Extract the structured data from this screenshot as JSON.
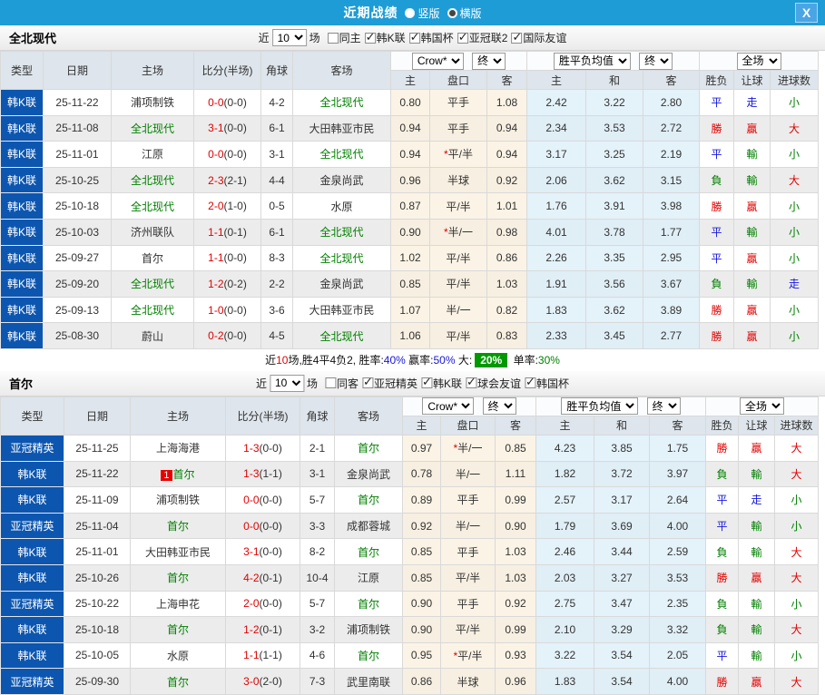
{
  "titlebar": {
    "title": "近期战绩",
    "radio_vertical": "竖版",
    "radio_horizontal": "横版",
    "vertical_checked": false,
    "horizontal_checked": true,
    "close_label": "X"
  },
  "colors": {
    "titlebar_bg": "#1e9cd6",
    "type_column_bg": "#0c56b0",
    "win_red": "#e10000",
    "lose_green": "#008000",
    "draw_blue": "#1515dd",
    "badge_green": "#009900"
  },
  "sections": [
    {
      "team": "全北现代",
      "filter": {
        "near_label": "近",
        "count_value": "10",
        "games_label": "场",
        "same_label": "同主",
        "same_checked": false,
        "leagues": [
          {
            "label": "韩K联",
            "checked": true
          },
          {
            "label": "韩国杯",
            "checked": true
          },
          {
            "label": "亚冠联2",
            "checked": true
          },
          {
            "label": "国际友谊",
            "checked": true
          }
        ]
      },
      "controls": {
        "bookmaker": "Crow*",
        "final1": "终",
        "avg": "胜平负均值",
        "final2": "终",
        "scope": "全场"
      },
      "header": {
        "type": "类型",
        "date": "日期",
        "home": "主场",
        "score": "比分(半场)",
        "corner": "角球",
        "away": "客场",
        "h": "主",
        "pan": "盘口",
        "a": "客",
        "h2": "主",
        "draw": "和",
        "a2": "客",
        "result": "胜负",
        "handicap_result": "让球",
        "goals": "进球数"
      },
      "rows": [
        {
          "type": "韩K联",
          "date": "25-11-22",
          "badge": "",
          "home": "浦项制铁",
          "home_c": "",
          "score": "0-0",
          "half": "(0-0)",
          "corner": "4-2",
          "away": "全北现代",
          "away_c": "green",
          "o1h": "0.80",
          "star": "",
          "pan": "平手",
          "o1a": "1.08",
          "o2h": "2.42",
          "o2d": "3.22",
          "o2a": "2.80",
          "res": "平",
          "res_c": "blue",
          "let": "走",
          "let_c": "blue",
          "goal": "小",
          "goal_c": "green"
        },
        {
          "type": "韩K联",
          "date": "25-11-08",
          "badge": "",
          "home": "全北现代",
          "home_c": "green",
          "score": "3-1",
          "half": "(0-0)",
          "corner": "6-1",
          "away": "大田韩亚市民",
          "away_c": "",
          "o1h": "0.94",
          "star": "",
          "pan": "平手",
          "o1a": "0.94",
          "o2h": "2.34",
          "o2d": "3.53",
          "o2a": "2.72",
          "res": "勝",
          "res_c": "red",
          "let": "贏",
          "let_c": "red",
          "goal": "大",
          "goal_c": "red"
        },
        {
          "type": "韩K联",
          "date": "25-11-01",
          "badge": "",
          "home": "江原",
          "home_c": "",
          "score": "0-0",
          "half": "(0-0)",
          "corner": "3-1",
          "away": "全北现代",
          "away_c": "green",
          "o1h": "0.94",
          "star": "*",
          "pan": "平/半",
          "o1a": "0.94",
          "o2h": "3.17",
          "o2d": "3.25",
          "o2a": "2.19",
          "res": "平",
          "res_c": "blue",
          "let": "輸",
          "let_c": "green",
          "goal": "小",
          "goal_c": "green"
        },
        {
          "type": "韩K联",
          "date": "25-10-25",
          "badge": "",
          "home": "全北现代",
          "home_c": "green",
          "score": "2-3",
          "half": "(2-1)",
          "corner": "4-4",
          "away": "金泉尚武",
          "away_c": "",
          "o1h": "0.96",
          "star": "",
          "pan": "半球",
          "o1a": "0.92",
          "o2h": "2.06",
          "o2d": "3.62",
          "o2a": "3.15",
          "res": "負",
          "res_c": "green",
          "let": "輸",
          "let_c": "green",
          "goal": "大",
          "goal_c": "red"
        },
        {
          "type": "韩K联",
          "date": "25-10-18",
          "badge": "",
          "home": "全北现代",
          "home_c": "green",
          "score": "2-0",
          "half": "(1-0)",
          "corner": "0-5",
          "away": "水原",
          "away_c": "",
          "o1h": "0.87",
          "star": "",
          "pan": "平/半",
          "o1a": "1.01",
          "o2h": "1.76",
          "o2d": "3.91",
          "o2a": "3.98",
          "res": "勝",
          "res_c": "red",
          "let": "贏",
          "let_c": "red",
          "goal": "小",
          "goal_c": "green"
        },
        {
          "type": "韩K联",
          "date": "25-10-03",
          "badge": "",
          "home": "济州联队",
          "home_c": "",
          "score": "1-1",
          "half": "(0-1)",
          "corner": "6-1",
          "away": "全北现代",
          "away_c": "green",
          "o1h": "0.90",
          "star": "*",
          "pan": "半/一",
          "o1a": "0.98",
          "o2h": "4.01",
          "o2d": "3.78",
          "o2a": "1.77",
          "res": "平",
          "res_c": "blue",
          "let": "輸",
          "let_c": "green",
          "goal": "小",
          "goal_c": "green"
        },
        {
          "type": "韩K联",
          "date": "25-09-27",
          "badge": "",
          "home": "首尔",
          "home_c": "",
          "score": "1-1",
          "half": "(0-0)",
          "corner": "8-3",
          "away": "全北现代",
          "away_c": "green",
          "o1h": "1.02",
          "star": "",
          "pan": "平/半",
          "o1a": "0.86",
          "o2h": "2.26",
          "o2d": "3.35",
          "o2a": "2.95",
          "res": "平",
          "res_c": "blue",
          "let": "贏",
          "let_c": "red",
          "goal": "小",
          "goal_c": "green"
        },
        {
          "type": "韩K联",
          "date": "25-09-20",
          "badge": "",
          "home": "全北现代",
          "home_c": "green",
          "score": "1-2",
          "half": "(0-2)",
          "corner": "2-2",
          "away": "金泉尚武",
          "away_c": "",
          "o1h": "0.85",
          "star": "",
          "pan": "平/半",
          "o1a": "1.03",
          "o2h": "1.91",
          "o2d": "3.56",
          "o2a": "3.67",
          "res": "負",
          "res_c": "green",
          "let": "輸",
          "let_c": "green",
          "goal": "走",
          "goal_c": "blue"
        },
        {
          "type": "韩K联",
          "date": "25-09-13",
          "badge": "",
          "home": "全北现代",
          "home_c": "green",
          "score": "1-0",
          "half": "(0-0)",
          "corner": "3-6",
          "away": "大田韩亚市民",
          "away_c": "",
          "o1h": "1.07",
          "star": "",
          "pan": "半/一",
          "o1a": "0.82",
          "o2h": "1.83",
          "o2d": "3.62",
          "o2a": "3.89",
          "res": "勝",
          "res_c": "red",
          "let": "贏",
          "let_c": "red",
          "goal": "小",
          "goal_c": "green"
        },
        {
          "type": "韩K联",
          "date": "25-08-30",
          "badge": "",
          "home": "蔚山",
          "home_c": "",
          "score": "0-2",
          "half": "(0-0)",
          "corner": "4-5",
          "away": "全北现代",
          "away_c": "green",
          "o1h": "1.06",
          "star": "",
          "pan": "平/半",
          "o1a": "0.83",
          "o2h": "2.33",
          "o2d": "3.45",
          "o2a": "2.77",
          "res": "勝",
          "res_c": "red",
          "let": "贏",
          "let_c": "red",
          "goal": "小",
          "goal_c": "green"
        }
      ],
      "summary": [
        {
          "t": "近",
          "c": ""
        },
        {
          "t": "10",
          "c": "red"
        },
        {
          "t": "场,胜4平4负2, 胜率:",
          "c": ""
        },
        {
          "t": "40%",
          "c": "blue"
        },
        {
          "t": " 赢率:",
          "c": ""
        },
        {
          "t": "50%",
          "c": "blue"
        },
        {
          "t": " 大:",
          "c": ""
        },
        {
          "t": "20%",
          "c": "badge"
        },
        {
          "t": " 单率:",
          "c": ""
        },
        {
          "t": "30%",
          "c": "green"
        }
      ]
    },
    {
      "team": "首尔",
      "filter": {
        "near_label": "近",
        "count_value": "10",
        "games_label": "场",
        "same_label": "同客",
        "same_checked": false,
        "leagues": [
          {
            "label": "亚冠精英",
            "checked": true
          },
          {
            "label": "韩K联",
            "checked": true
          },
          {
            "label": "球会友谊",
            "checked": true
          },
          {
            "label": "韩国杯",
            "checked": true
          }
        ]
      },
      "controls": {
        "bookmaker": "Crow*",
        "final1": "终",
        "avg": "胜平负均值",
        "final2": "终",
        "scope": "全场"
      },
      "header": {
        "type": "类型",
        "date": "日期",
        "home": "主场",
        "score": "比分(半场)",
        "corner": "角球",
        "away": "客场",
        "h": "主",
        "pan": "盘口",
        "a": "客",
        "h2": "主",
        "draw": "和",
        "a2": "客",
        "result": "胜负",
        "handicap_result": "让球",
        "goals": "进球数"
      },
      "rows": [
        {
          "type": "亚冠精英",
          "date": "25-11-25",
          "badge": "",
          "home": "上海海港",
          "home_c": "",
          "score": "1-3",
          "half": "(0-0)",
          "corner": "2-1",
          "away": "首尔",
          "away_c": "green",
          "o1h": "0.97",
          "star": "*",
          "pan": "半/一",
          "o1a": "0.85",
          "o2h": "4.23",
          "o2d": "3.85",
          "o2a": "1.75",
          "res": "勝",
          "res_c": "red",
          "let": "贏",
          "let_c": "red",
          "goal": "大",
          "goal_c": "red"
        },
        {
          "type": "韩K联",
          "date": "25-11-22",
          "badge": "1",
          "home": "首尔",
          "home_c": "green",
          "score": "1-3",
          "half": "(1-1)",
          "corner": "3-1",
          "away": "金泉尚武",
          "away_c": "",
          "o1h": "0.78",
          "star": "",
          "pan": "半/一",
          "o1a": "1.11",
          "o2h": "1.82",
          "o2d": "3.72",
          "o2a": "3.97",
          "res": "負",
          "res_c": "green",
          "let": "輸",
          "let_c": "green",
          "goal": "大",
          "goal_c": "red"
        },
        {
          "type": "韩K联",
          "date": "25-11-09",
          "badge": "",
          "home": "浦项制铁",
          "home_c": "",
          "score": "0-0",
          "half": "(0-0)",
          "corner": "5-7",
          "away": "首尔",
          "away_c": "green",
          "o1h": "0.89",
          "star": "",
          "pan": "平手",
          "o1a": "0.99",
          "o2h": "2.57",
          "o2d": "3.17",
          "o2a": "2.64",
          "res": "平",
          "res_c": "blue",
          "let": "走",
          "let_c": "blue",
          "goal": "小",
          "goal_c": "green"
        },
        {
          "type": "亚冠精英",
          "date": "25-11-04",
          "badge": "",
          "home": "首尔",
          "home_c": "green",
          "score": "0-0",
          "half": "(0-0)",
          "corner": "3-3",
          "away": "成都蓉城",
          "away_c": "",
          "o1h": "0.92",
          "star": "",
          "pan": "半/一",
          "o1a": "0.90",
          "o2h": "1.79",
          "o2d": "3.69",
          "o2a": "4.00",
          "res": "平",
          "res_c": "blue",
          "let": "輸",
          "let_c": "green",
          "goal": "小",
          "goal_c": "green"
        },
        {
          "type": "韩K联",
          "date": "25-11-01",
          "badge": "",
          "home": "大田韩亚市民",
          "home_c": "",
          "score": "3-1",
          "half": "(0-0)",
          "corner": "8-2",
          "away": "首尔",
          "away_c": "green",
          "o1h": "0.85",
          "star": "",
          "pan": "平手",
          "o1a": "1.03",
          "o2h": "2.46",
          "o2d": "3.44",
          "o2a": "2.59",
          "res": "負",
          "res_c": "green",
          "let": "輸",
          "let_c": "green",
          "goal": "大",
          "goal_c": "red"
        },
        {
          "type": "韩K联",
          "date": "25-10-26",
          "badge": "",
          "home": "首尔",
          "home_c": "green",
          "score": "4-2",
          "half": "(0-1)",
          "corner": "10-4",
          "away": "江原",
          "away_c": "",
          "o1h": "0.85",
          "star": "",
          "pan": "平/半",
          "o1a": "1.03",
          "o2h": "2.03",
          "o2d": "3.27",
          "o2a": "3.53",
          "res": "勝",
          "res_c": "red",
          "let": "贏",
          "let_c": "red",
          "goal": "大",
          "goal_c": "red"
        },
        {
          "type": "亚冠精英",
          "date": "25-10-22",
          "badge": "",
          "home": "上海申花",
          "home_c": "",
          "score": "2-0",
          "half": "(0-0)",
          "corner": "5-7",
          "away": "首尔",
          "away_c": "green",
          "o1h": "0.90",
          "star": "",
          "pan": "平手",
          "o1a": "0.92",
          "o2h": "2.75",
          "o2d": "3.47",
          "o2a": "2.35",
          "res": "負",
          "res_c": "green",
          "let": "輸",
          "let_c": "green",
          "goal": "小",
          "goal_c": "green"
        },
        {
          "type": "韩K联",
          "date": "25-10-18",
          "badge": "",
          "home": "首尔",
          "home_c": "green",
          "score": "1-2",
          "half": "(0-1)",
          "corner": "3-2",
          "away": "浦项制铁",
          "away_c": "",
          "o1h": "0.90",
          "star": "",
          "pan": "平/半",
          "o1a": "0.99",
          "o2h": "2.10",
          "o2d": "3.29",
          "o2a": "3.32",
          "res": "負",
          "res_c": "green",
          "let": "輸",
          "let_c": "green",
          "goal": "大",
          "goal_c": "red"
        },
        {
          "type": "韩K联",
          "date": "25-10-05",
          "badge": "",
          "home": "水原",
          "home_c": "",
          "score": "1-1",
          "half": "(1-1)",
          "corner": "4-6",
          "away": "首尔",
          "away_c": "green",
          "o1h": "0.95",
          "star": "*",
          "pan": "平/半",
          "o1a": "0.93",
          "o2h": "3.22",
          "o2d": "3.54",
          "o2a": "2.05",
          "res": "平",
          "res_c": "blue",
          "let": "輸",
          "let_c": "green",
          "goal": "小",
          "goal_c": "green"
        },
        {
          "type": "亚冠精英",
          "date": "25-09-30",
          "badge": "",
          "home": "首尔",
          "home_c": "green",
          "score": "3-0",
          "half": "(2-0)",
          "corner": "7-3",
          "away": "武里南联",
          "away_c": "",
          "o1h": "0.86",
          "star": "",
          "pan": "半球",
          "o1a": "0.96",
          "o2h": "1.83",
          "o2d": "3.54",
          "o2a": "4.00",
          "res": "勝",
          "res_c": "red",
          "let": "贏",
          "let_c": "red",
          "goal": "大",
          "goal_c": "red"
        }
      ],
      "summary": []
    }
  ]
}
